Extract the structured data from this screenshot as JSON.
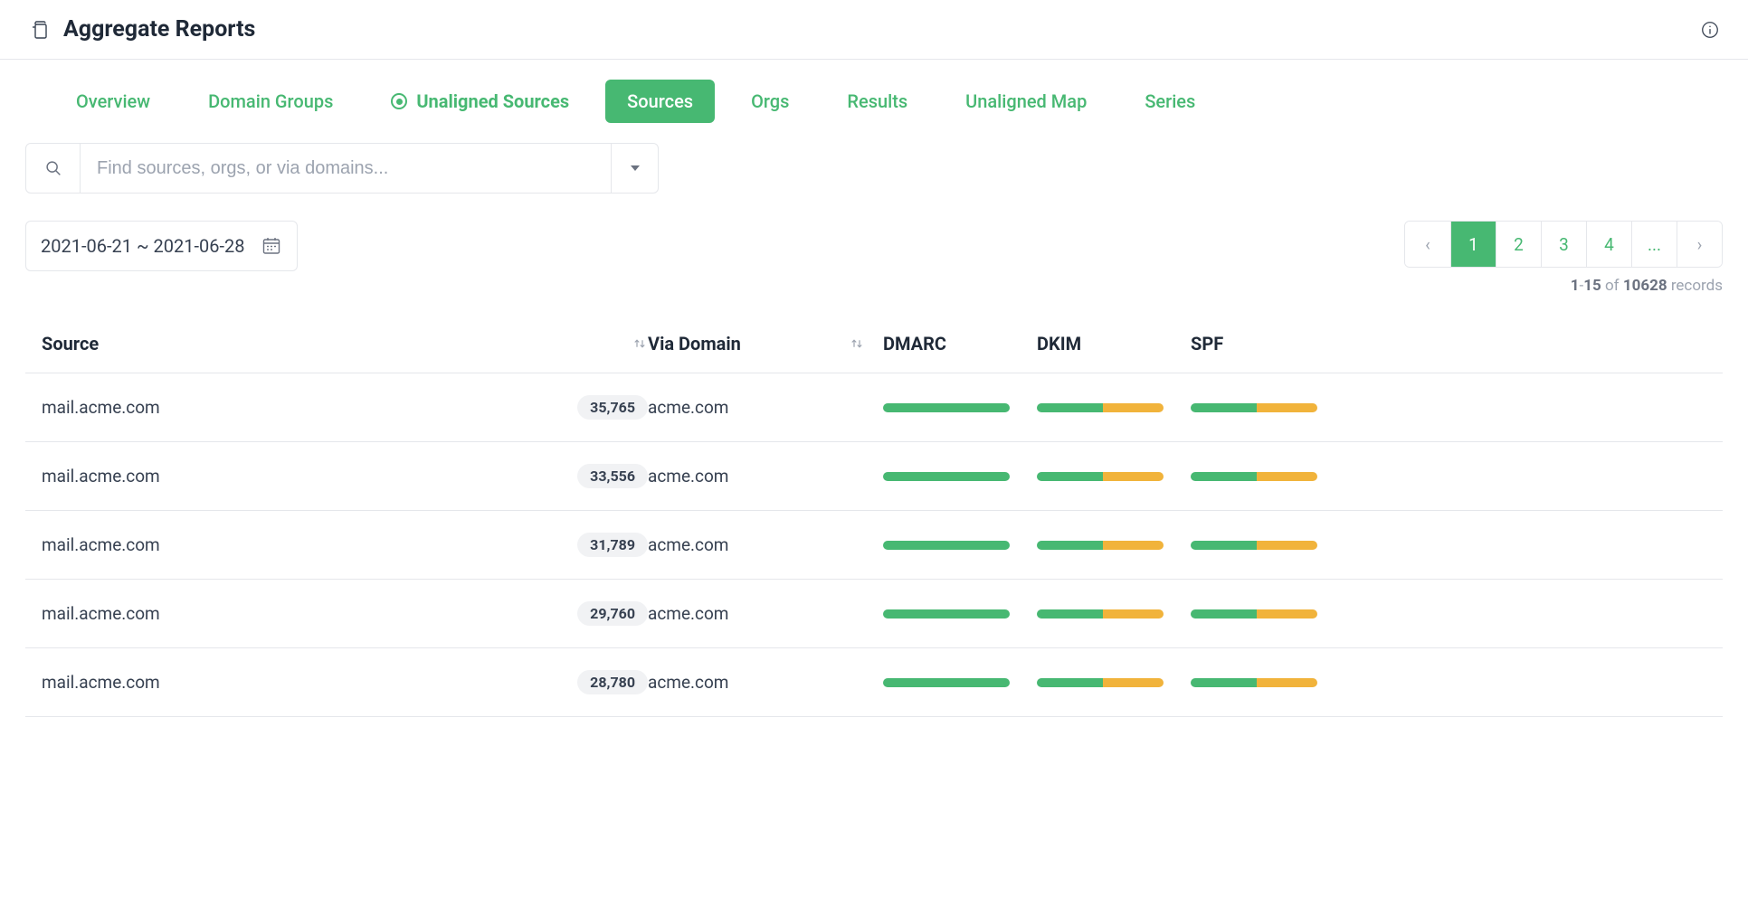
{
  "header": {
    "title": "Aggregate Reports"
  },
  "tabs": {
    "overview": "Overview",
    "domain_groups": "Domain Groups",
    "unaligned_sources": "Unaligned Sources",
    "sources": "Sources",
    "orgs": "Orgs",
    "results": "Results",
    "unaligned_map": "Unaligned Map",
    "series": "Series"
  },
  "search": {
    "placeholder": "Find sources, orgs, or via domains..."
  },
  "date_range": "2021-06-21 ~ 2021-06-28",
  "pagination": {
    "pages": [
      "1",
      "2",
      "3",
      "4",
      "..."
    ],
    "active_index": 0,
    "range_start": "1",
    "range_end": "15",
    "total": "10628",
    "records_label": "records",
    "of_label": "of"
  },
  "table": {
    "columns": {
      "source": "Source",
      "via_domain": "Via Domain",
      "dmarc": "DMARC",
      "dkim": "DKIM",
      "spf": "SPF"
    },
    "rows": [
      {
        "source": "mail.acme.com",
        "count": "35,765",
        "via": "acme.com",
        "dmarc": [
          100,
          0
        ],
        "dkim": [
          52,
          48
        ],
        "spf": [
          52,
          48
        ]
      },
      {
        "source": "mail.acme.com",
        "count": "33,556",
        "via": "acme.com",
        "dmarc": [
          100,
          0
        ],
        "dkim": [
          52,
          48
        ],
        "spf": [
          52,
          48
        ]
      },
      {
        "source": "mail.acme.com",
        "count": "31,789",
        "via": "acme.com",
        "dmarc": [
          100,
          0
        ],
        "dkim": [
          52,
          48
        ],
        "spf": [
          52,
          48
        ]
      },
      {
        "source": "mail.acme.com",
        "count": "29,760",
        "via": "acme.com",
        "dmarc": [
          100,
          0
        ],
        "dkim": [
          52,
          48
        ],
        "spf": [
          52,
          48
        ]
      },
      {
        "source": "mail.acme.com",
        "count": "28,780",
        "via": "acme.com",
        "dmarc": [
          100,
          0
        ],
        "dkim": [
          52,
          48
        ],
        "spf": [
          52,
          48
        ]
      }
    ]
  },
  "colors": {
    "accent": "#47b872",
    "orange": "#f1b33b"
  }
}
